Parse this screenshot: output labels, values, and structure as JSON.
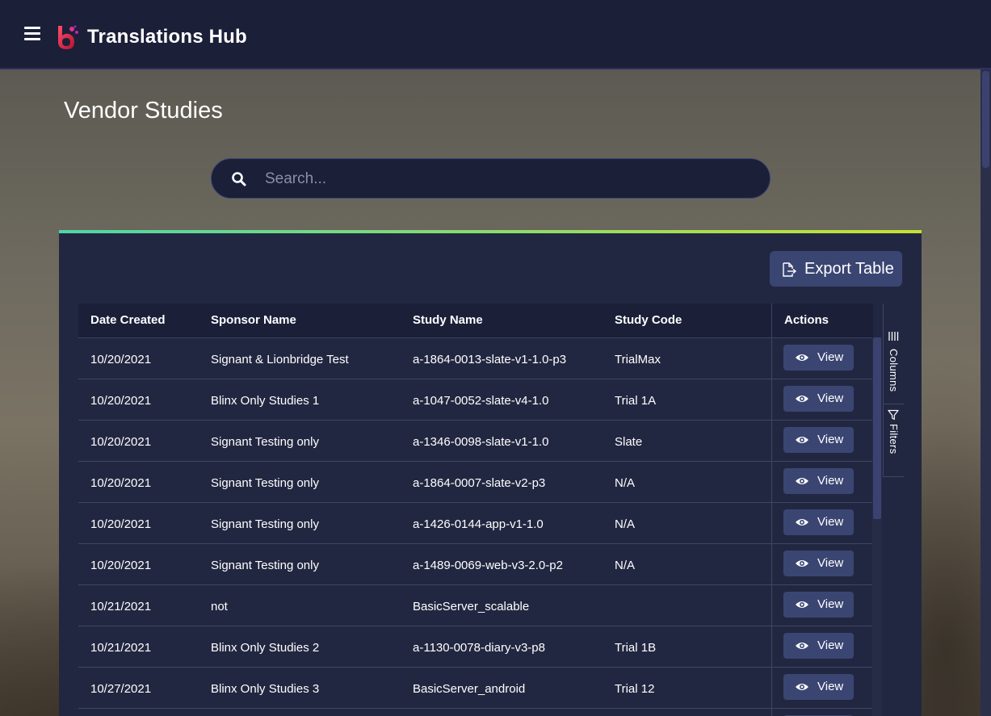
{
  "header": {
    "app_title": "Translations Hub",
    "menu_icon": "hamburger-menu-icon",
    "logo_icon": "translations-hub-logo"
  },
  "page": {
    "title": "Vendor Studies"
  },
  "search": {
    "placeholder": "Search...",
    "value": "",
    "icon": "search-icon"
  },
  "toolbar": {
    "export_label": "Export Table",
    "export_icon": "export-file-icon"
  },
  "table": {
    "columns": [
      "Date Created",
      "Sponsor Name",
      "Study Name",
      "Study Code",
      "Actions"
    ],
    "view_label": "View",
    "rows": [
      {
        "date": "10/20/2021",
        "sponsor": "Signant & Lionbridge Test",
        "study": "a-1864-0013-slate-v1-1.0-p3",
        "code": "TrialMax"
      },
      {
        "date": "10/20/2021",
        "sponsor": "Blinx Only Studies 1",
        "study": "a-1047-0052-slate-v4-1.0",
        "code": "Trial 1A"
      },
      {
        "date": "10/20/2021",
        "sponsor": "Signant Testing only",
        "study": "a-1346-0098-slate-v1-1.0",
        "code": "Slate"
      },
      {
        "date": "10/20/2021",
        "sponsor": "Signant Testing only",
        "study": "a-1864-0007-slate-v2-p3",
        "code": "N/A"
      },
      {
        "date": "10/20/2021",
        "sponsor": "Signant Testing only",
        "study": "a-1426-0144-app-v1-1.0",
        "code": "N/A"
      },
      {
        "date": "10/20/2021",
        "sponsor": "Signant Testing only",
        "study": "a-1489-0069-web-v3-2.0-p2",
        "code": "N/A"
      },
      {
        "date": "10/21/2021",
        "sponsor": "not",
        "study": "BasicServer_scalable",
        "code": ""
      },
      {
        "date": "10/21/2021",
        "sponsor": "Blinx Only Studies 2",
        "study": "a-1130-0078-diary-v3-p8",
        "code": "Trial 1B"
      },
      {
        "date": "10/27/2021",
        "sponsor": "Blinx Only Studies 3",
        "study": "BasicServer_android",
        "code": "Trial 12"
      }
    ]
  },
  "side_panel": {
    "columns_label": "Columns",
    "filters_label": "Filters"
  },
  "colors": {
    "header_bg": "#1b1f38",
    "panel_bg": "#222741",
    "button_bg": "#3a4572",
    "accent_start": "#4ed6a8",
    "accent_end": "#c5e232"
  }
}
